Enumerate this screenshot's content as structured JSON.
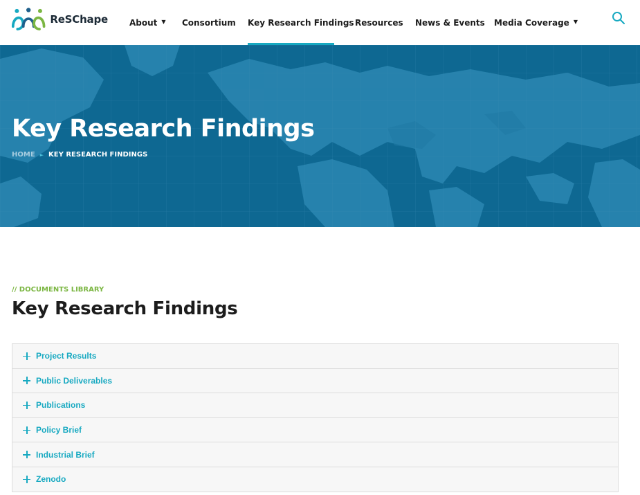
{
  "brand": {
    "name": "ReSChape",
    "colors": {
      "blue": "#17a9c1",
      "green": "#7bb642",
      "dark_blue": "#1f5f8b"
    }
  },
  "nav": {
    "items": [
      {
        "label": "About",
        "has_dropdown": true
      },
      {
        "label": "Consortium",
        "has_dropdown": false
      },
      {
        "label": "Key Research Findings",
        "has_dropdown": false,
        "active": true
      },
      {
        "label": "Resources",
        "has_dropdown": false
      },
      {
        "label": "News & Events",
        "has_dropdown": false
      },
      {
        "label": "Media Coverage",
        "has_dropdown": true
      }
    ],
    "dropdown_glyph": "▼",
    "search_icon": "search-icon"
  },
  "hero": {
    "title": "Key Research Findings",
    "breadcrumb": {
      "home": "HOME",
      "separator": "►",
      "current": "KEY RESEARCH FINDINGS"
    }
  },
  "section": {
    "eyebrow": "// DOCUMENTS LIBRARY",
    "title": "Key Research Findings"
  },
  "accordion": {
    "items": [
      {
        "label": "Project Results"
      },
      {
        "label": "Public Deliverables"
      },
      {
        "label": "Publications"
      },
      {
        "label": "Policy Brief"
      },
      {
        "label": "Industrial Brief"
      },
      {
        "label": "Zenodo"
      }
    ]
  }
}
